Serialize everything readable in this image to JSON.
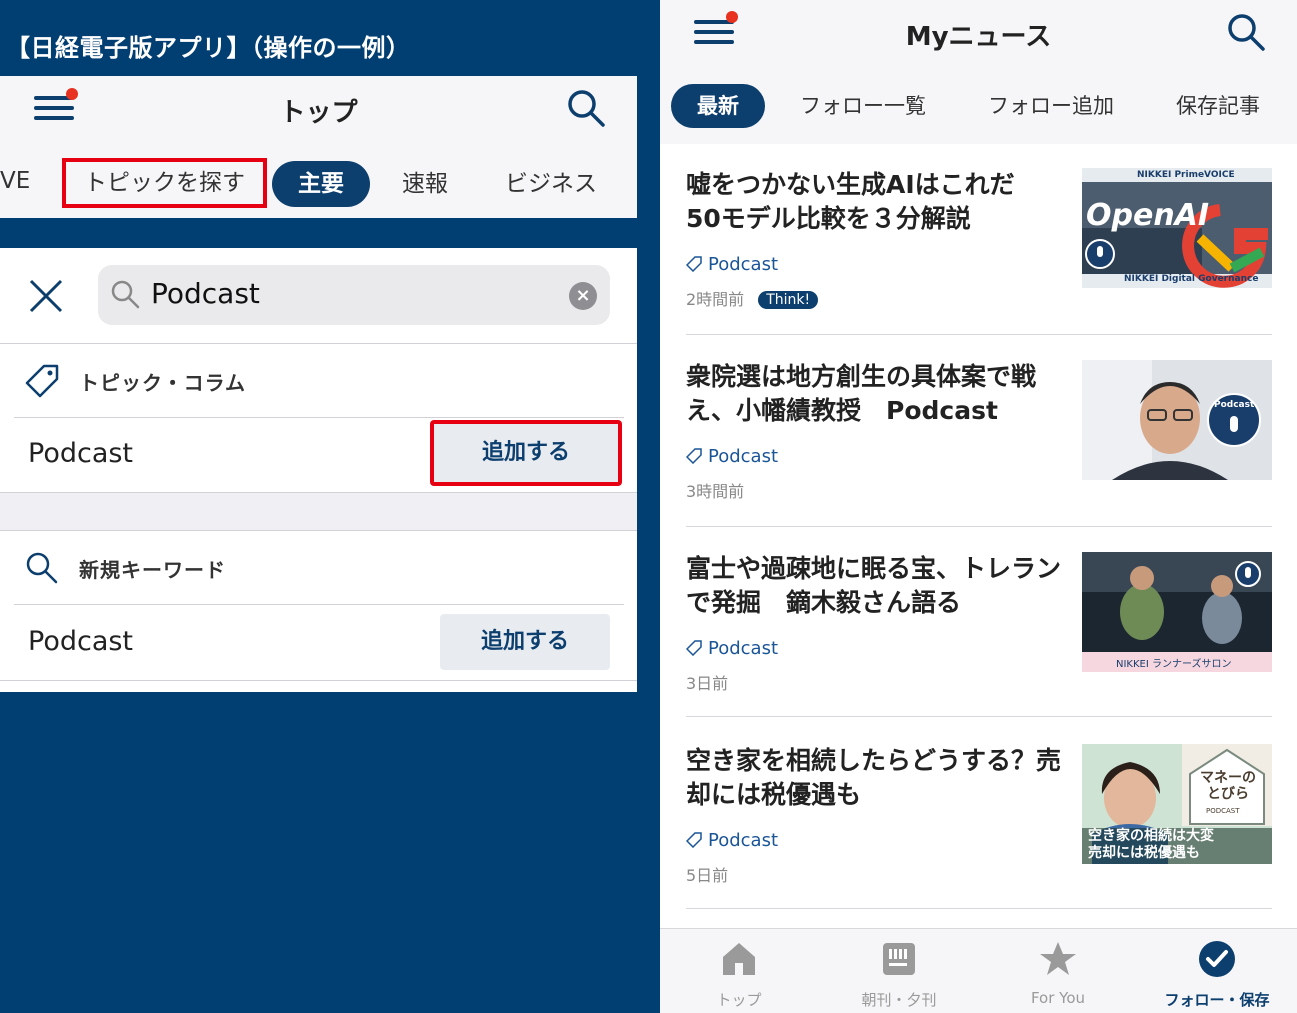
{
  "caption": "【日経電子版アプリ】（操作の一例）",
  "left_screen": {
    "header_title": "トップ",
    "tabs": [
      {
        "label": "VE"
      },
      {
        "label": "トピックを探す"
      },
      {
        "label": "主要"
      },
      {
        "label": "速報"
      },
      {
        "label": "ビジネス"
      }
    ],
    "search": {
      "value": "Podcast",
      "clear_label": "×"
    },
    "topic_section": {
      "heading": "トピック・コラム",
      "item": "Podcast",
      "button": "追加する"
    },
    "keyword_section": {
      "heading": "新規キーワード",
      "item": "Podcast",
      "button": "追加する"
    }
  },
  "right_screen": {
    "header_title": "Myニュース",
    "tabs": [
      {
        "label": "最新"
      },
      {
        "label": "フォロー一覧"
      },
      {
        "label": "フォロー追加"
      },
      {
        "label": "保存記事"
      }
    ],
    "articles": [
      {
        "title": "嘘をつかない生成AIはこれだ　50モデル比較を３分解説",
        "tag": "Podcast",
        "time": "2時間前",
        "badge": "Think!",
        "thumb_top": "NIKKEI PrimeVOICE",
        "thumb_mid": "OpenAI",
        "thumb_bottom": "NIKKEI Digital Governance"
      },
      {
        "title": "衆院選は地方創生の具体案で戦え、小幡績教授　Podcast",
        "tag": "Podcast",
        "time": "3時間前",
        "thumb_mid": "Podcast"
      },
      {
        "title": "富士や過疎地に眠る宝、トレランで発掘　鏑木毅さん語る",
        "tag": "Podcast",
        "time": "3日前",
        "thumb_bottom": "NIKKEI ランナーズサロン"
      },
      {
        "title": "空き家を相続したらどうする？売却には税優遇も",
        "tag": "Podcast",
        "time": "5日前",
        "thumb_top": "マネーのとびら",
        "thumb_sub": "PODCAST",
        "thumb_bottom": "空き家の相続は大変\n売却には税優遇も"
      }
    ],
    "bottom_nav": [
      {
        "label": "トップ"
      },
      {
        "label": "朝刊・夕刊"
      },
      {
        "label": "For You"
      },
      {
        "label": "フォロー・保存"
      }
    ]
  },
  "colors": {
    "navy": "#0c3e6e",
    "background_blue": "#013e72",
    "highlight_red": "#e60012",
    "notification_dot": "#e8311e",
    "tag_blue": "#1a5597"
  }
}
